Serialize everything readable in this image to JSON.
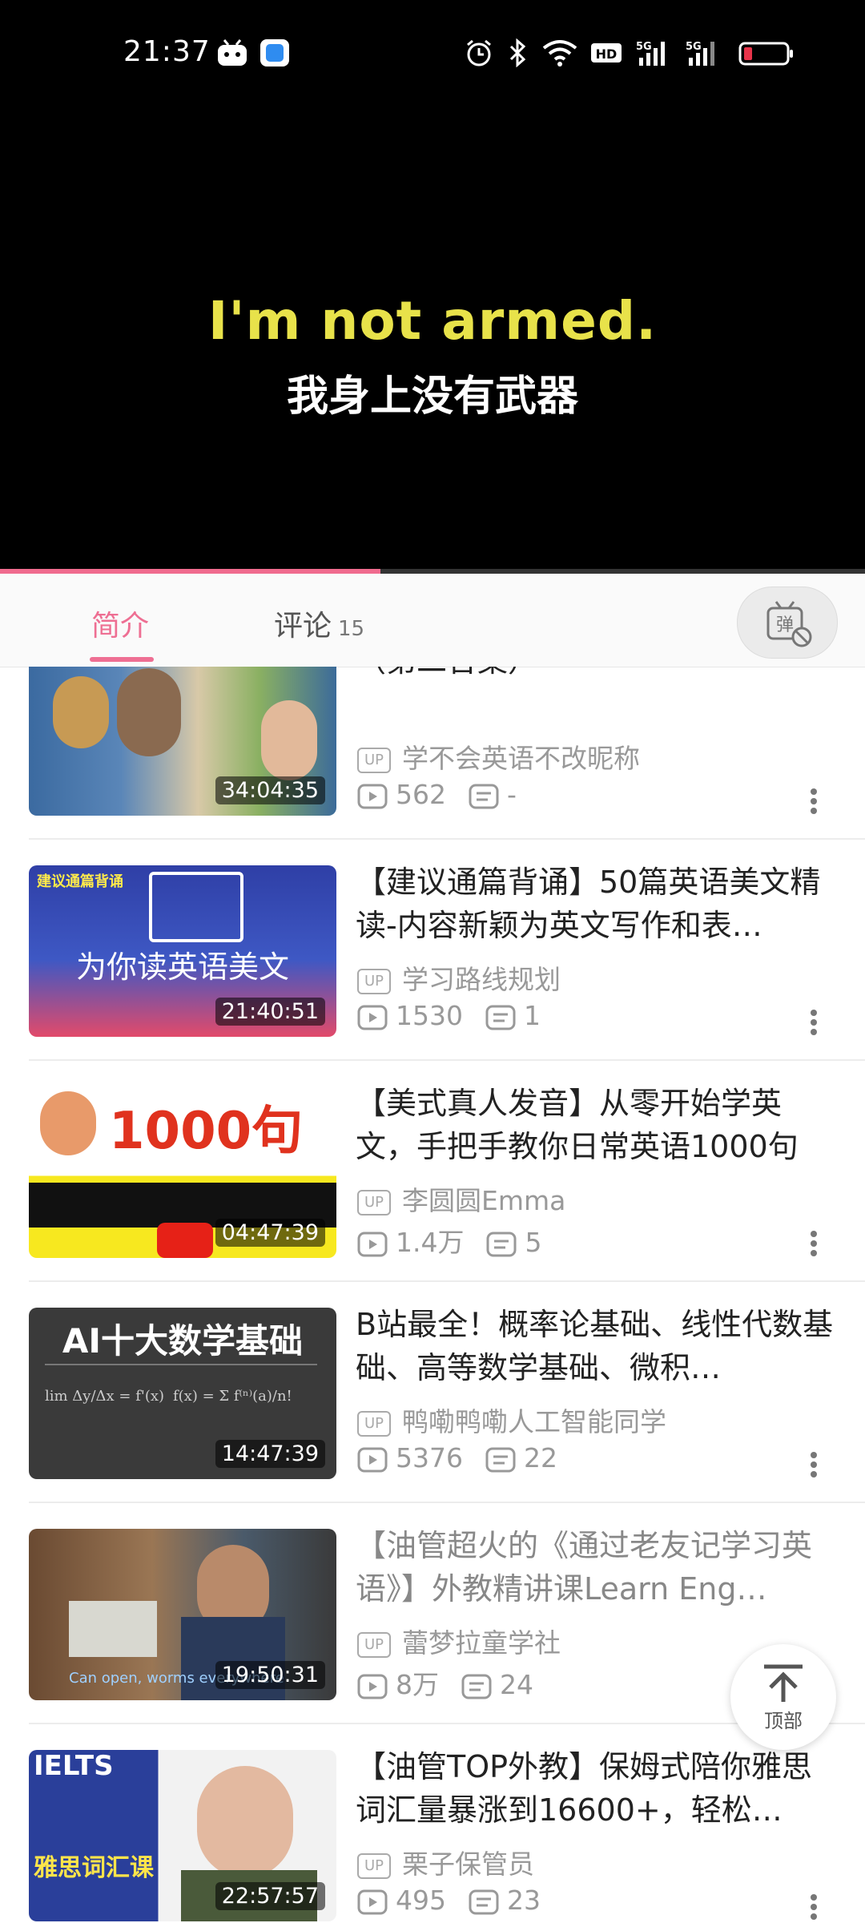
{
  "status_bar": {
    "time": "21:37",
    "icons": [
      "bilibili-app-icon",
      "app-icon",
      "alarm-icon",
      "bluetooth-icon",
      "wifi-icon",
      "hd-icon",
      "5g-signal-icon",
      "5g-signal-icon",
      "battery-low-icon"
    ],
    "battery_color": "#e8344a"
  },
  "video": {
    "subtitle_en": "I'm not armed.",
    "subtitle_zh": "我身上没有武器",
    "progress": 0.44,
    "progress_color": "#f06b8e"
  },
  "tabs": {
    "intro_label": "简介",
    "comment_label": "评论",
    "comment_count": "15",
    "danmaku_icon": "danmaku-toggle-icon",
    "accent": "#ee6f93"
  },
  "list": [
    {
      "title": "（第二合集）",
      "uploader": "学不会英语不改昵称",
      "duration": "34:04:35",
      "plays": "562",
      "danmaku": "-",
      "thumb_text": ""
    },
    {
      "title": "【建议通篇背诵】50篇英语美文精读-内容新颖为英文写作和表…",
      "uploader": "学习路线规划",
      "duration": "21:40:51",
      "plays": "1530",
      "danmaku": "1",
      "thumb_text": "为你读英语美文"
    },
    {
      "title": "【美式真人发音】从零开始学英文，手把手教你日常英语1000句",
      "uploader": "李圆圆Emma",
      "duration": "04:47:39",
      "plays": "1.4万",
      "danmaku": "5",
      "thumb_text": "1000句"
    },
    {
      "title": "B站最全！概率论基础、线性代数基础、高等数学基础、微积…",
      "uploader": "鸭嘞鸭嘞人工智能同学",
      "duration": "14:47:39",
      "plays": "5376",
      "danmaku": "22",
      "thumb_text": "AI十大数学基础"
    },
    {
      "title": "【油管超火的《通过老友记学习英语》】外教精讲课Learn Eng…",
      "uploader": "蕾梦拉童学社",
      "duration": "19:50:31",
      "plays": "8万",
      "danmaku": "24",
      "thumb_text": "Can open, worms everywhere"
    },
    {
      "title": "【油管TOP外教】保姆式陪你雅思词汇量暴涨到16600+，轻松…",
      "uploader": "栗子保管员",
      "duration": "22:57:57",
      "plays": "495",
      "danmaku": "23",
      "thumb_text": "雅思词汇课"
    }
  ],
  "top_button": {
    "label": "顶部",
    "icon": "arrow-up-to-top-icon"
  },
  "up_badge_label": "UP"
}
